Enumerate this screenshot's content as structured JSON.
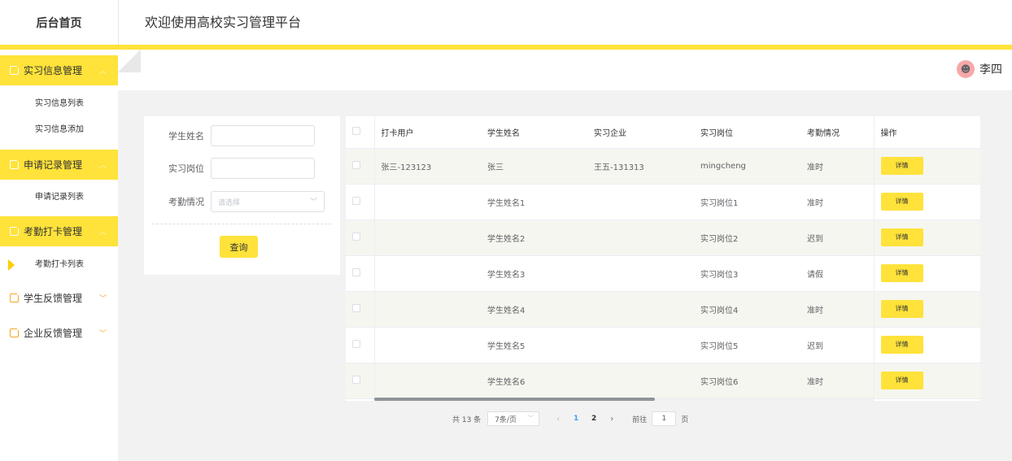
{
  "header": {
    "logo": "后台首页",
    "title": "欢迎使用高校实习管理平台"
  },
  "user": {
    "avatar_icon": "avatar-icon",
    "name": "李四"
  },
  "sidebar": {
    "groups": [
      {
        "label": "实习信息管理",
        "active": true,
        "items": [
          "实习信息列表",
          "实习信息添加"
        ]
      },
      {
        "label": "申请记录管理",
        "active": true,
        "items": [
          "申请记录列表"
        ]
      },
      {
        "label": "考勤打卡管理",
        "active": true,
        "items": [
          "考勤打卡列表"
        ]
      },
      {
        "label": "学生反馈管理",
        "active": false,
        "items": []
      },
      {
        "label": "企业反馈管理",
        "active": false,
        "items": []
      }
    ],
    "current_item": "考勤打卡列表"
  },
  "search": {
    "student_name_label": "学生姓名",
    "student_name_value": "",
    "position_label": "实习岗位",
    "position_value": "",
    "attendance_label": "考勤情况",
    "attendance_placeholder": "请选择",
    "query_button": "查询"
  },
  "table": {
    "columns": [
      "打卡用户",
      "学生姓名",
      "实习企业",
      "实习岗位",
      "考勤情况",
      "操作"
    ],
    "rows": [
      {
        "user": "张三-123123",
        "student": "张三",
        "company": "王五-131313",
        "position": "mingcheng",
        "attendance": "准时",
        "action": "详情"
      },
      {
        "user": "",
        "student": "学生姓名1",
        "company": "",
        "position": "实习岗位1",
        "attendance": "准时",
        "action": "详情"
      },
      {
        "user": "",
        "student": "学生姓名2",
        "company": "",
        "position": "实习岗位2",
        "attendance": "迟到",
        "action": "详情"
      },
      {
        "user": "",
        "student": "学生姓名3",
        "company": "",
        "position": "实习岗位3",
        "attendance": "请假",
        "action": "详情"
      },
      {
        "user": "",
        "student": "学生姓名4",
        "company": "",
        "position": "实习岗位4",
        "attendance": "准时",
        "action": "详情"
      },
      {
        "user": "",
        "student": "学生姓名5",
        "company": "",
        "position": "实习岗位5",
        "attendance": "迟到",
        "action": "详情"
      },
      {
        "user": "",
        "student": "学生姓名6",
        "company": "",
        "position": "实习岗位6",
        "attendance": "准时",
        "action": "详情"
      }
    ]
  },
  "pagination": {
    "total": "共 13 条",
    "page_size": "7条/页",
    "pages": [
      "1",
      "2"
    ],
    "current_page": "1",
    "goto_label": "前往",
    "goto_value": "1",
    "page_suffix": "页"
  },
  "colors": {
    "accent": "#ffe23a",
    "icon": "#f5a623",
    "page_bg": "#f2f2f2",
    "pager_current": "#409eff"
  }
}
